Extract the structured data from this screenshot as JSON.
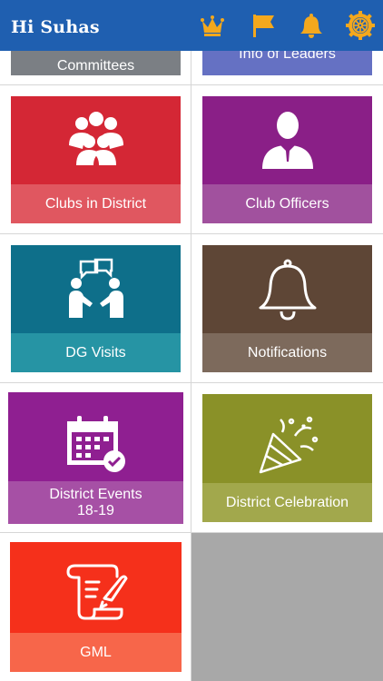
{
  "header": {
    "greeting": "Hi Suhas",
    "icons": [
      "crown-icon",
      "flag-icon",
      "bell-icon",
      "rotary-wheel-icon"
    ],
    "background_color": "#1f5fb0",
    "icon_color": "#f4a81d"
  },
  "tiles": {
    "committees": {
      "label": "Committees",
      "color": "#7b7f84"
    },
    "info_of_leaders": {
      "label": "Info of Leaders",
      "color": "#6571c3"
    },
    "clubs_in_district": {
      "label": "Clubs in District",
      "color": "#d42735",
      "band_color": "#e05760",
      "icon": "group-icon"
    },
    "club_officers": {
      "label": "Club Officers",
      "color": "#8a1f87",
      "band_color": "#a1519e",
      "icon": "officer-icon"
    },
    "dg_visits": {
      "label": "DG Visits",
      "color": "#0e6f8a",
      "band_color": "#2694a4",
      "icon": "meeting-chat-icon"
    },
    "notifications": {
      "label": "Notifications",
      "color": "#5e4636",
      "band_color": "#7d6a5c",
      "icon": "bell-outline-icon"
    },
    "district_events": {
      "label_line1": "District Events",
      "label_line2": "18-19",
      "color": "#8f1f91",
      "band_color": "#a650a5",
      "icon": "calendar-check-icon"
    },
    "district_celebration": {
      "label": "District Celebration",
      "color": "#8a9128",
      "band_color": "#a2a84c",
      "icon": "party-popper-icon"
    },
    "gml": {
      "label": "GML",
      "color": "#f5301b",
      "band_color": "#f7664a",
      "icon": "scroll-quill-icon"
    }
  }
}
